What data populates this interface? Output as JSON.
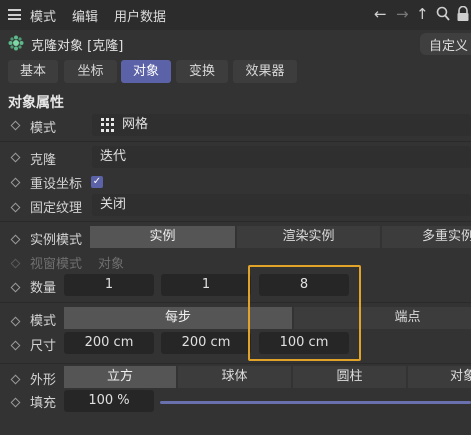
{
  "menu": {
    "items": [
      "模式",
      "编辑",
      "用户数据"
    ],
    "nav_icons": [
      "arrow-left-icon",
      "arrow-right-icon",
      "arrow-up-icon",
      "search-icon",
      "lock-icon"
    ]
  },
  "header": {
    "object_title": "克隆对象 [克隆]",
    "preset_label": "自定义"
  },
  "tabs": [
    "基本",
    "坐标",
    "对象",
    "变换",
    "效果器"
  ],
  "active_tab": "对象",
  "section_title": "对象属性",
  "props": {
    "mode": {
      "label": "模式",
      "value": "网格"
    },
    "clone": {
      "label": "克隆",
      "value": "迭代"
    },
    "reset_coords": {
      "label": "重设坐标",
      "checked": true
    },
    "fix_texture": {
      "label": "固定纹理",
      "value": "关闭"
    },
    "instance_mode": {
      "label": "实例模式",
      "options": [
        "实例",
        "渲染实例",
        "多重实例"
      ],
      "selected": "实例"
    },
    "viewport_mode": {
      "label": "视窗模式",
      "value": "对象"
    },
    "count": {
      "label": "数量",
      "values": [
        "1",
        "1",
        "8"
      ]
    },
    "grid_mode": {
      "label": "模式",
      "options": [
        "每步",
        "端点"
      ],
      "selected": "每步"
    },
    "size": {
      "label": "尺寸",
      "values": [
        "200 cm",
        "200 cm",
        "100 cm"
      ]
    },
    "shape": {
      "label": "外形",
      "options": [
        "立方",
        "球体",
        "圆柱",
        "对象"
      ],
      "selected": "立方"
    },
    "fill": {
      "label": "填充",
      "value": "100 %",
      "fraction": 1.0
    }
  },
  "colors": {
    "accent": "#5b62a8",
    "highlight_box": "#e2a428",
    "background": "#333333"
  }
}
